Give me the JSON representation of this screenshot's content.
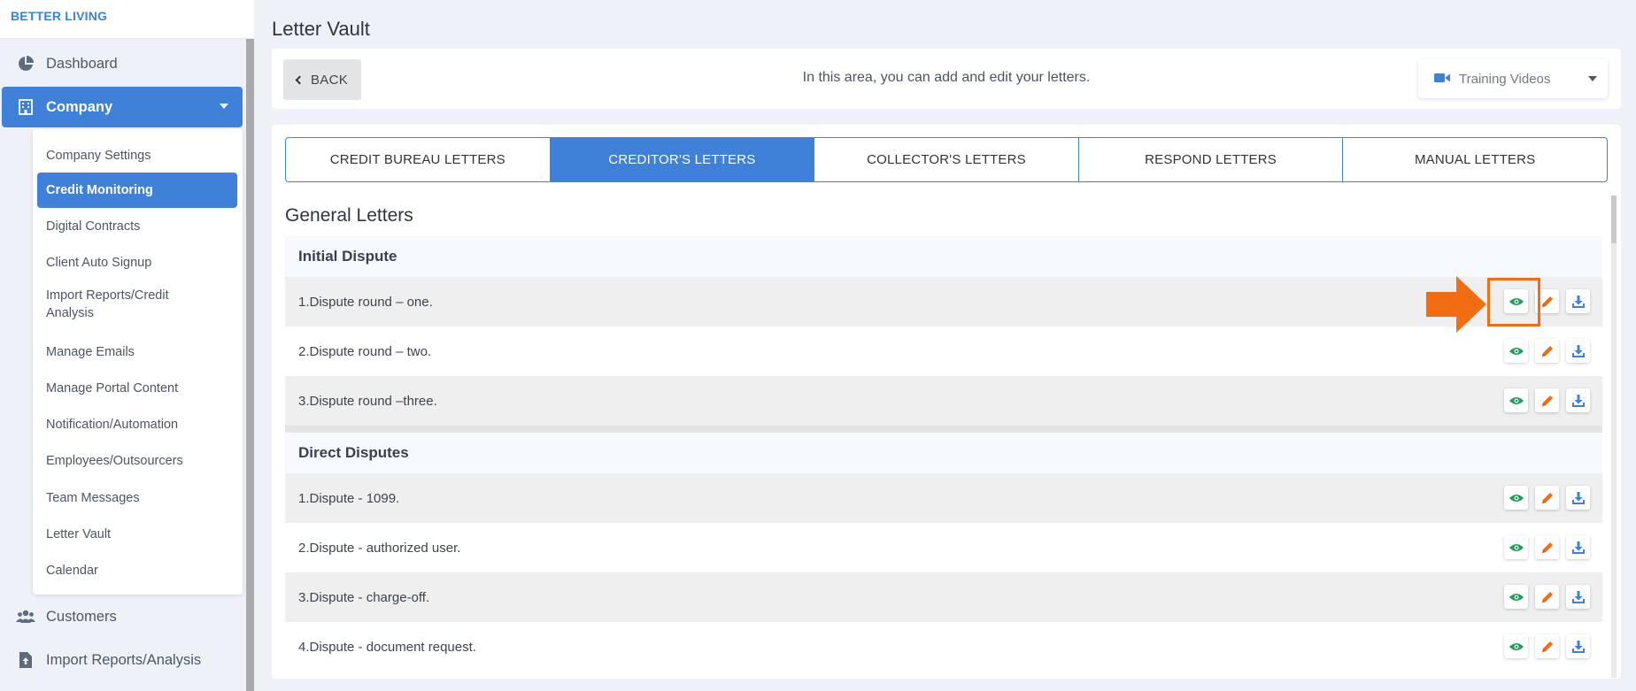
{
  "brand": "BETTER LIVING",
  "sidebar": {
    "dashboard": "Dashboard",
    "company": "Company",
    "submenu": [
      "Company Settings",
      "Credit Monitoring",
      "Digital Contracts",
      "Client Auto Signup",
      "Import Reports/Credit Analysis",
      "Manage Emails",
      "Manage Portal Content",
      "Notification/Automation",
      "Employees/Outsourcers",
      "Team Messages",
      "Letter Vault",
      "Calendar"
    ],
    "customers": "Customers",
    "import_reports": "Import Reports/Analysis"
  },
  "page": {
    "title": "Letter Vault",
    "back_label": "BACK",
    "message": "In this area, you can add and edit your letters.",
    "training_label": "Training Videos"
  },
  "tabs": [
    "CREDIT BUREAU LETTERS",
    "CREDITOR'S LETTERS",
    "COLLECTOR'S LETTERS",
    "RESPOND LETTERS",
    "MANUAL LETTERS"
  ],
  "section_title": "General Letters",
  "groups": [
    {
      "title": "Initial Dispute",
      "letters": [
        "1.Dispute round – one.",
        "2.Dispute round – two.",
        "3.Dispute round –three."
      ]
    },
    {
      "title": "Direct Disputes",
      "letters": [
        "1.Dispute - 1099.",
        "2.Dispute - authorized user.",
        "3.Dispute - charge-off.",
        "4.Dispute - document request."
      ]
    }
  ],
  "colors": {
    "accent": "#3f80d8",
    "view": "#1e9e5a",
    "edit": "#f26d12",
    "download": "#3f80d8",
    "annotation": "#f26d12"
  },
  "icons": [
    "pie-chart-icon",
    "building-icon",
    "users-icon",
    "file-upload-icon",
    "chevron-left-icon",
    "video-camera-icon",
    "eye-icon",
    "pencil-icon",
    "download-icon",
    "arrow-right-icon"
  ]
}
